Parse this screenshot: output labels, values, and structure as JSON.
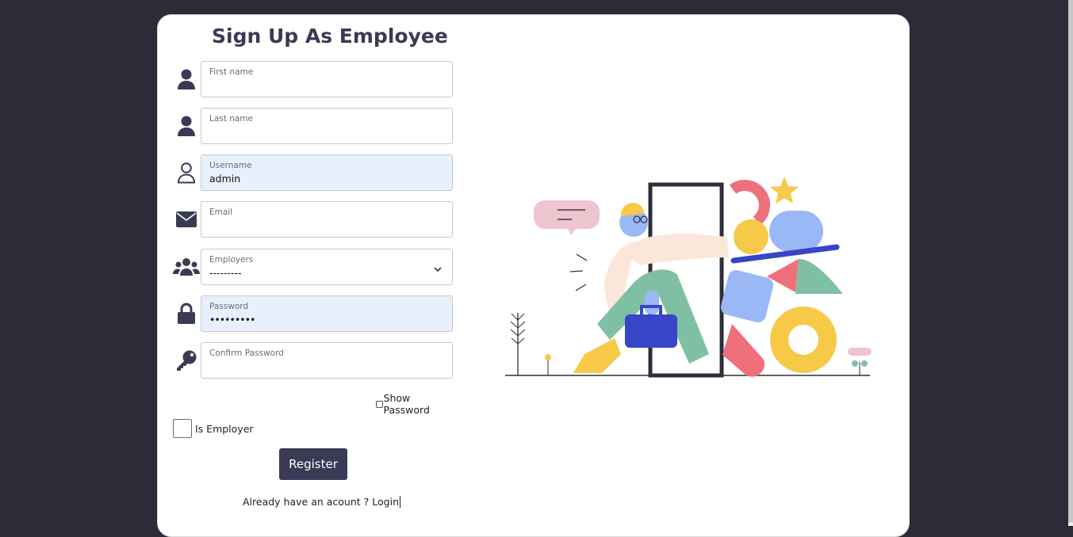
{
  "page": {
    "title": "Sign Up As Employee"
  },
  "form": {
    "first_name": {
      "label": "First name",
      "value": "",
      "icon": "user-icon"
    },
    "last_name": {
      "label": "Last name",
      "value": "",
      "icon": "user-icon"
    },
    "username": {
      "label": "Username",
      "value": "admin",
      "icon": "user-outline-icon"
    },
    "email": {
      "label": "Email",
      "value": "",
      "icon": "envelope-icon"
    },
    "employers": {
      "label": "Employers",
      "selected": "---------",
      "icon": "users-icon"
    },
    "password": {
      "label": "Password",
      "value": "•••••••••",
      "icon": "lock-icon"
    },
    "confirm_password": {
      "label": "Confirm Password",
      "value": "",
      "icon": "key-icon"
    },
    "show_password_label": "Show Password",
    "is_employer_label": "Is Employer",
    "register_label": "Register",
    "login_prompt": "Already have an acount ? ",
    "login_link": "Login"
  },
  "colors": {
    "background": "#2c2b38",
    "card": "#ffffff",
    "accent": "#3b3a55",
    "autofill": "#e8f0fe"
  }
}
